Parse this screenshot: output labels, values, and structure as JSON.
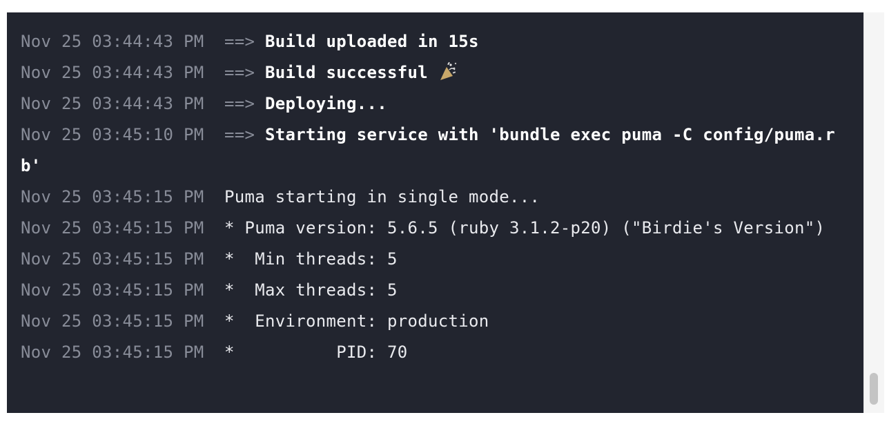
{
  "log": {
    "lines": [
      {
        "timestamp": "Nov 25 03:44:43 PM",
        "prefix": "==>",
        "message": "Build uploaded in 15s",
        "bold": true
      },
      {
        "timestamp": "Nov 25 03:44:43 PM",
        "prefix": "==>",
        "message": "Build successful",
        "bold": true,
        "icon": "party-popper-icon"
      },
      {
        "timestamp": "Nov 25 03:44:43 PM",
        "prefix": "==>",
        "message": "Deploying...",
        "bold": true
      },
      {
        "timestamp": "Nov 25 03:45:10 PM",
        "prefix": "==>",
        "message": "Starting service with 'bundle exec puma -C config/puma.rb'",
        "bold": true
      },
      {
        "timestamp": "Nov 25 03:45:15 PM",
        "prefix": "",
        "message": "Puma starting in single mode...",
        "bold": false
      },
      {
        "timestamp": "Nov 25 03:45:15 PM",
        "prefix": "",
        "message": "* Puma version: 5.6.5 (ruby 3.1.2-p20) (\"Birdie's Version\")",
        "bold": false
      },
      {
        "timestamp": "Nov 25 03:45:15 PM",
        "prefix": "",
        "message": "*  Min threads: 5",
        "bold": false
      },
      {
        "timestamp": "Nov 25 03:45:15 PM",
        "prefix": "",
        "message": "*  Max threads: 5",
        "bold": false
      },
      {
        "timestamp": "Nov 25 03:45:15 PM",
        "prefix": "",
        "message": "*  Environment: production",
        "bold": false
      },
      {
        "timestamp": "Nov 25 03:45:15 PM",
        "prefix": "",
        "message": "*          PID: 70",
        "bold": false
      }
    ]
  },
  "colors": {
    "background": "#22252f",
    "timestamp": "#888c98",
    "text": "#e9eaee"
  }
}
